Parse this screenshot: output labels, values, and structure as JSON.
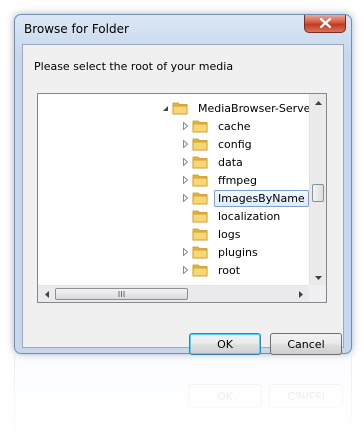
{
  "dialog": {
    "title": "Browse for Folder",
    "prompt": "Please select the root of your media"
  },
  "tree": {
    "root": {
      "label": "MediaBrowser-Server",
      "expanded": true
    },
    "children": [
      {
        "label": "cache",
        "has_children": true,
        "selected": false
      },
      {
        "label": "config",
        "has_children": true,
        "selected": false
      },
      {
        "label": "data",
        "has_children": true,
        "selected": false
      },
      {
        "label": "ffmpeg",
        "has_children": true,
        "selected": false
      },
      {
        "label": "ImagesByName",
        "has_children": true,
        "selected": true
      },
      {
        "label": "localization",
        "has_children": false,
        "selected": false
      },
      {
        "label": "logs",
        "has_children": false,
        "selected": false
      },
      {
        "label": "plugins",
        "has_children": true,
        "selected": false
      },
      {
        "label": "root",
        "has_children": true,
        "selected": false
      }
    ]
  },
  "buttons": {
    "ok": "OK",
    "cancel": "Cancel"
  },
  "colors": {
    "folder": "#f2c94c",
    "selection_border": "#7da2ce",
    "close_button": "#c9462c"
  },
  "icons": {
    "folder": "folder-icon",
    "expander": "chevron-right-icon",
    "expanded": "triangle-down-icon",
    "close": "close-icon"
  }
}
